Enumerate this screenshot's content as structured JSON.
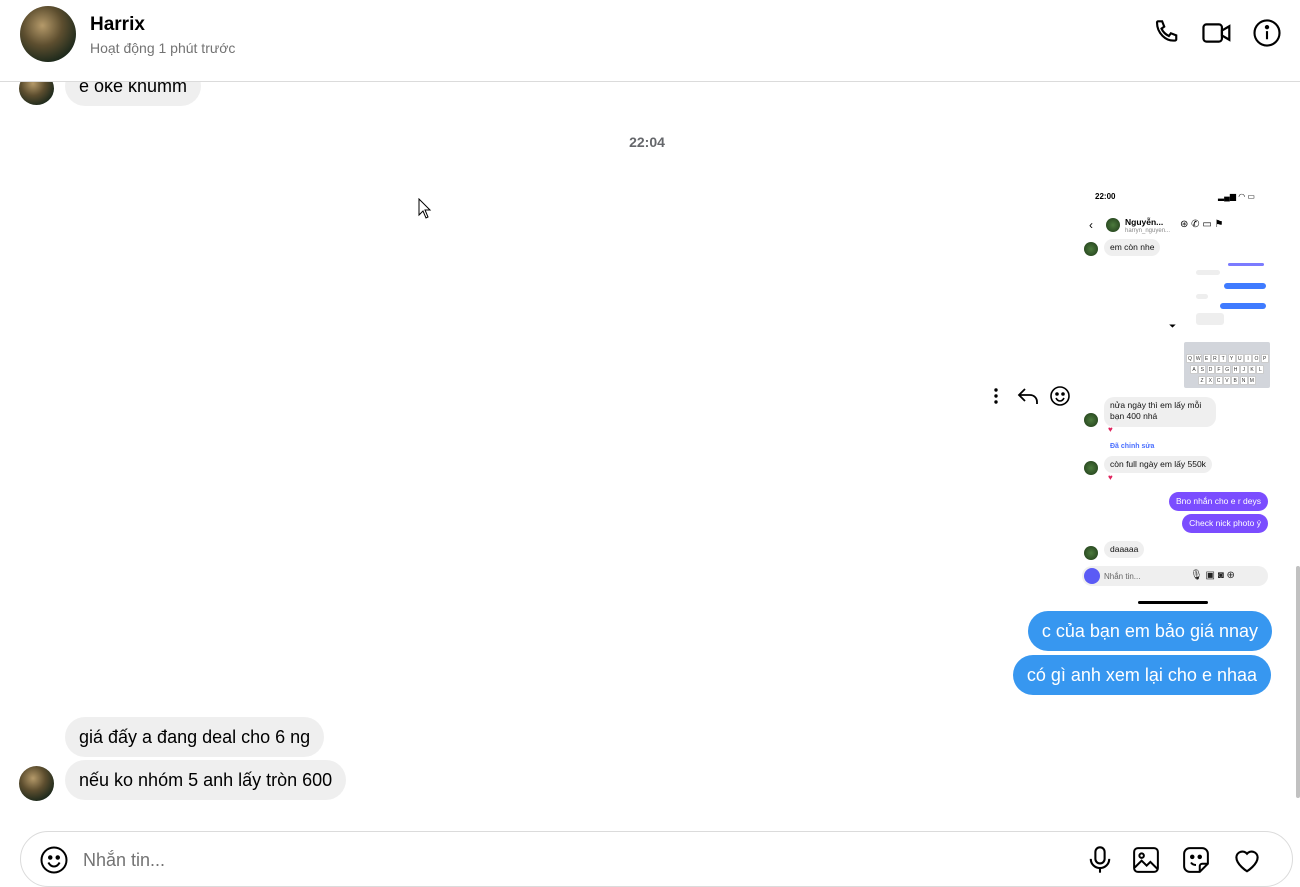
{
  "header": {
    "name": "Harrix",
    "status": "Hoạt động 1 phút trước"
  },
  "messages": {
    "top_partial": "e oke khumm",
    "timestamp": "22:04",
    "outgoing_1": "c của bạn em bảo giá nnay",
    "outgoing_2": "có gì anh xem lại cho e nhaa",
    "incoming_1": "giá đấy a đang deal cho 6 ng",
    "incoming_2": "nếu ko nhóm 5 anh lấy tròn 600"
  },
  "screenshot": {
    "time": "22:00",
    "contact_name": "Nguyễn...",
    "contact_handle": "harryn_nguyen...",
    "msg_1": "em còn nhe",
    "msg_2": "nửa ngày thì em lấy mỗi bạn 400 nhá",
    "edited_label": "Đã chỉnh sửa",
    "msg_3": "còn full ngày em lấy 550k",
    "out_1": "Bno nhắn cho e r deys",
    "out_2": "Check nick photo ý",
    "msg_4": "daaaaa",
    "composer_placeholder": "Nhắn tin...",
    "keyboard_row1": [
      "Q",
      "W",
      "E",
      "R",
      "T",
      "Y",
      "U",
      "I",
      "O",
      "P"
    ],
    "keyboard_row2": [
      "A",
      "S",
      "D",
      "F",
      "G",
      "H",
      "J",
      "K",
      "L"
    ],
    "keyboard_row3": [
      "Z",
      "X",
      "C",
      "V",
      "B",
      "N",
      "M"
    ]
  },
  "composer": {
    "placeholder": "Nhắn tin..."
  },
  "colors": {
    "outgoing": "#3797f0",
    "incoming": "#efefef",
    "shot_outgoing": "#7b4dff"
  }
}
